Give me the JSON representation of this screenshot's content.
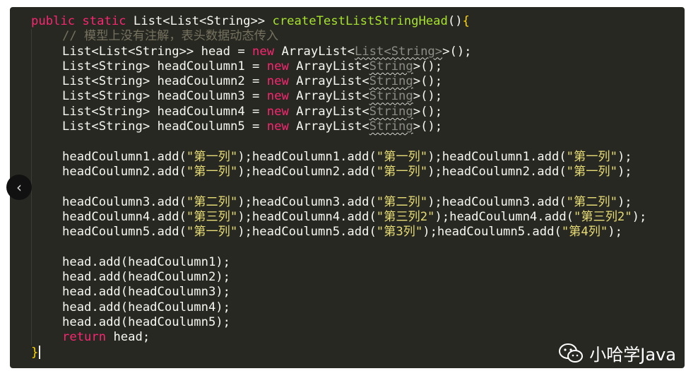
{
  "editor": {
    "lines": [
      {
        "indent": 0,
        "tokens": [
          {
            "t": "public static ",
            "c": "kw"
          },
          {
            "t": "List<List<String>> ",
            "c": "pl"
          },
          {
            "t": "createTestListStringHead",
            "c": "fn"
          },
          {
            "t": "()",
            "c": "pl"
          },
          {
            "t": "{",
            "c": "brace-hl"
          }
        ]
      },
      {
        "indent": 1,
        "tokens": [
          {
            "t": "// 模型上没有注解，表头数据动态传入",
            "c": "cm"
          }
        ]
      },
      {
        "indent": 1,
        "tokens": [
          {
            "t": "List<List<String>> head = ",
            "c": "pl"
          },
          {
            "t": "new ",
            "c": "kw"
          },
          {
            "t": "ArrayList<",
            "c": "pl"
          },
          {
            "t": "List<String>",
            "c": "squig"
          },
          {
            "t": ">();",
            "c": "pl"
          }
        ]
      },
      {
        "indent": 1,
        "tokens": [
          {
            "t": "List<String> headCoulumn1 = ",
            "c": "pl"
          },
          {
            "t": "new ",
            "c": "kw"
          },
          {
            "t": "ArrayList<",
            "c": "pl"
          },
          {
            "t": "String",
            "c": "squig"
          },
          {
            "t": ">();",
            "c": "pl"
          }
        ]
      },
      {
        "indent": 1,
        "tokens": [
          {
            "t": "List<String> headCoulumn2 = ",
            "c": "pl"
          },
          {
            "t": "new ",
            "c": "kw"
          },
          {
            "t": "ArrayList<",
            "c": "pl"
          },
          {
            "t": "String",
            "c": "squig"
          },
          {
            "t": ">();",
            "c": "pl"
          }
        ]
      },
      {
        "indent": 1,
        "tokens": [
          {
            "t": "List<String> headCoulumn3 = ",
            "c": "pl"
          },
          {
            "t": "new ",
            "c": "kw"
          },
          {
            "t": "ArrayList<",
            "c": "pl"
          },
          {
            "t": "String",
            "c": "squig"
          },
          {
            "t": ">();",
            "c": "pl"
          }
        ]
      },
      {
        "indent": 1,
        "tokens": [
          {
            "t": "List<String> headCoulumn4 = ",
            "c": "pl"
          },
          {
            "t": "new ",
            "c": "kw"
          },
          {
            "t": "ArrayList<",
            "c": "pl"
          },
          {
            "t": "String",
            "c": "squig"
          },
          {
            "t": ">();",
            "c": "pl"
          }
        ]
      },
      {
        "indent": 1,
        "tokens": [
          {
            "t": "List<String> headCoulumn5 = ",
            "c": "pl"
          },
          {
            "t": "new ",
            "c": "kw"
          },
          {
            "t": "ArrayList<",
            "c": "pl"
          },
          {
            "t": "String",
            "c": "squig"
          },
          {
            "t": ">();",
            "c": "pl"
          }
        ]
      },
      {
        "indent": 1,
        "tokens": []
      },
      {
        "indent": 1,
        "tokens": [
          {
            "t": "headCoulumn1.add(",
            "c": "pl"
          },
          {
            "t": "\"第一列\"",
            "c": "str"
          },
          {
            "t": ");headCoulumn1.add(",
            "c": "pl"
          },
          {
            "t": "\"第一列\"",
            "c": "str"
          },
          {
            "t": ");headCoulumn1.add(",
            "c": "pl"
          },
          {
            "t": "\"第一列\"",
            "c": "str"
          },
          {
            "t": ");",
            "c": "pl"
          }
        ]
      },
      {
        "indent": 1,
        "tokens": [
          {
            "t": "headCoulumn2.add(",
            "c": "pl"
          },
          {
            "t": "\"第一列\"",
            "c": "str"
          },
          {
            "t": ");headCoulumn2.add(",
            "c": "pl"
          },
          {
            "t": "\"第一列\"",
            "c": "str"
          },
          {
            "t": ");headCoulumn2.add(",
            "c": "pl"
          },
          {
            "t": "\"第一列\"",
            "c": "str"
          },
          {
            "t": ");",
            "c": "pl"
          }
        ]
      },
      {
        "indent": 1,
        "tokens": []
      },
      {
        "indent": 1,
        "tokens": [
          {
            "t": "headCoulumn3.add(",
            "c": "pl"
          },
          {
            "t": "\"第二列\"",
            "c": "str"
          },
          {
            "t": ");headCoulumn3.add(",
            "c": "pl"
          },
          {
            "t": "\"第二列\"",
            "c": "str"
          },
          {
            "t": ");headCoulumn3.add(",
            "c": "pl"
          },
          {
            "t": "\"第二列\"",
            "c": "str"
          },
          {
            "t": ");",
            "c": "pl"
          }
        ]
      },
      {
        "indent": 1,
        "tokens": [
          {
            "t": "headCoulumn4.add(",
            "c": "pl"
          },
          {
            "t": "\"第三列\"",
            "c": "str"
          },
          {
            "t": ");headCoulumn4.add(",
            "c": "pl"
          },
          {
            "t": "\"第三列2\"",
            "c": "str"
          },
          {
            "t": ");headCoulumn4.add(",
            "c": "pl"
          },
          {
            "t": "\"第三列2\"",
            "c": "str"
          },
          {
            "t": ");",
            "c": "pl"
          }
        ]
      },
      {
        "indent": 1,
        "tokens": [
          {
            "t": "headCoulumn5.add(",
            "c": "pl"
          },
          {
            "t": "\"第一列\"",
            "c": "str"
          },
          {
            "t": ");headCoulumn5.add(",
            "c": "pl"
          },
          {
            "t": "\"第3列\"",
            "c": "str"
          },
          {
            "t": ");headCoulumn5.add(",
            "c": "pl"
          },
          {
            "t": "\"第4列\"",
            "c": "str"
          },
          {
            "t": ");",
            "c": "pl"
          }
        ]
      },
      {
        "indent": 1,
        "tokens": []
      },
      {
        "indent": 1,
        "tokens": [
          {
            "t": "head.add(headCoulumn1);",
            "c": "pl"
          }
        ]
      },
      {
        "indent": 1,
        "tokens": [
          {
            "t": "head.add(headCoulumn2);",
            "c": "pl"
          }
        ]
      },
      {
        "indent": 1,
        "tokens": [
          {
            "t": "head.add(headCoulumn3);",
            "c": "pl"
          }
        ]
      },
      {
        "indent": 1,
        "tokens": [
          {
            "t": "head.add(headCoulumn4);",
            "c": "pl"
          }
        ]
      },
      {
        "indent": 1,
        "tokens": [
          {
            "t": "head.add(headCoulumn5);",
            "c": "pl"
          }
        ]
      },
      {
        "indent": 1,
        "tokens": [
          {
            "t": "return ",
            "c": "kw"
          },
          {
            "t": "head;",
            "c": "pl"
          }
        ]
      },
      {
        "indent": 0,
        "tokens": [
          {
            "t": "}",
            "c": "brace-hl"
          }
        ],
        "cursor": true
      }
    ]
  },
  "nav": {
    "prev_icon": "chevron-left-icon",
    "prev_glyph": "‹"
  },
  "watermark": {
    "text": "小哈学Java",
    "icon": "wechat-icon"
  },
  "colors": {
    "background": "#272822",
    "keyword": "#f92672",
    "function": "#a6e22e",
    "string": "#e6db74",
    "comment": "#75715e"
  }
}
